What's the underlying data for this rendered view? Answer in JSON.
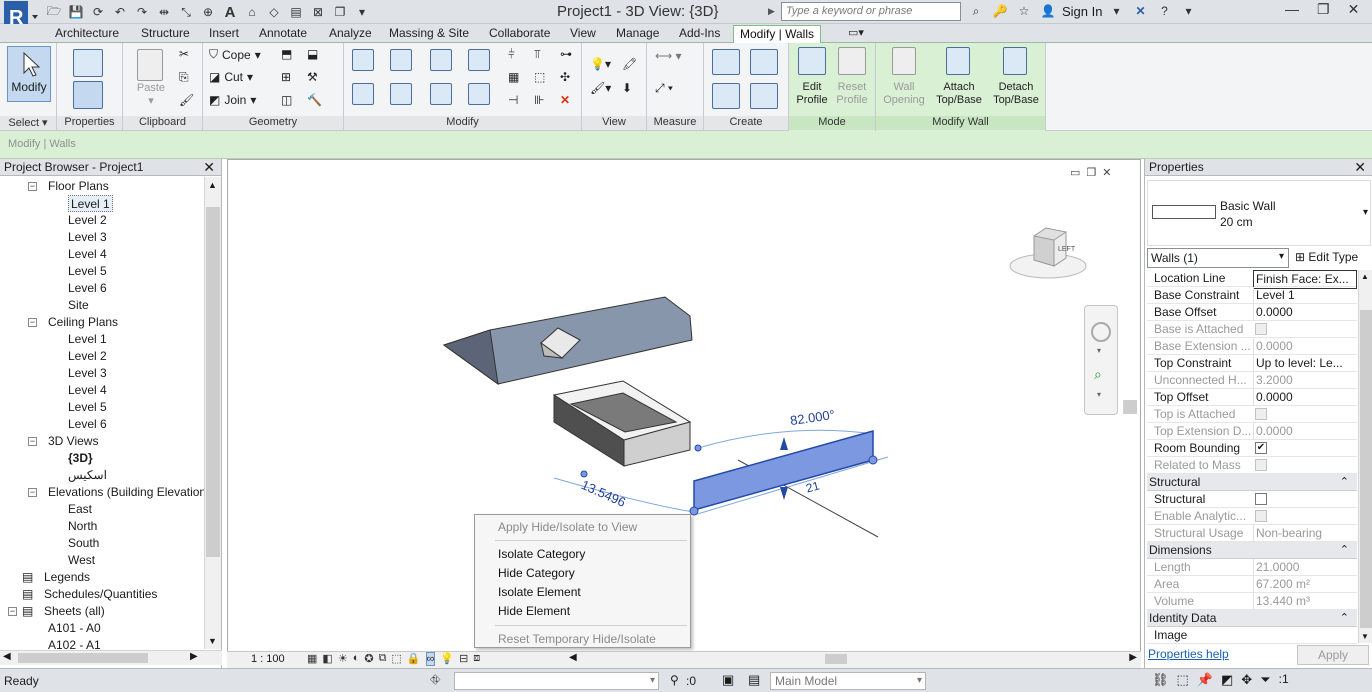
{
  "app": {
    "window_title": "Project1 - 3D View: {3D}",
    "search_placeholder": "Type a keyword or phrase",
    "sign_in": "Sign In",
    "brand_color": "#2a5ea8"
  },
  "tabs": [
    "Architecture",
    "Structure",
    "Insert",
    "Annotate",
    "Analyze",
    "Massing & Site",
    "Collaborate",
    "View",
    "Manage",
    "Add-Ins",
    "Modify | Walls"
  ],
  "ribbon": {
    "select_panel": {
      "modify": "Modify",
      "label": "Select"
    },
    "properties_panel": {
      "label": "Properties"
    },
    "clipboard_panel": {
      "paste": "Paste",
      "label": "Clipboard"
    },
    "geometry_panel": {
      "cope": "Cope",
      "cut": "Cut",
      "join": "Join",
      "label": "Geometry"
    },
    "modify_panel": {
      "label": "Modify"
    },
    "view_panel": {
      "label": "View"
    },
    "measure_panel": {
      "label": "Measure"
    },
    "create_panel": {
      "label": "Create"
    },
    "mode_panel": {
      "edit_profile": [
        "Edit",
        "Profile"
      ],
      "reset_profile": [
        "Reset",
        "Profile"
      ],
      "label": "Mode"
    },
    "modify_wall_panel": {
      "wall_opening": [
        "Wall",
        "Opening"
      ],
      "attach": [
        "Attach",
        "Top/Base"
      ],
      "detach": [
        "Detach",
        "Top/Base"
      ],
      "label": "Modify Wall"
    }
  },
  "context_label": "Modify | Walls",
  "project_browser": {
    "title": "Project Browser - Project1",
    "items": [
      {
        "text": "Floor Plans",
        "level": 1,
        "expander": "−"
      },
      {
        "text": "Level 1",
        "level": 2,
        "selected": true
      },
      {
        "text": "Level 2",
        "level": 2
      },
      {
        "text": "Level 3",
        "level": 2
      },
      {
        "text": "Level 4",
        "level": 2
      },
      {
        "text": "Level 5",
        "level": 2
      },
      {
        "text": "Level 6",
        "level": 2
      },
      {
        "text": "Site",
        "level": 2
      },
      {
        "text": "Ceiling Plans",
        "level": 1,
        "expander": "−"
      },
      {
        "text": "Level 1",
        "level": 2
      },
      {
        "text": "Level 2",
        "level": 2
      },
      {
        "text": "Level 3",
        "level": 2
      },
      {
        "text": "Level 4",
        "level": 2
      },
      {
        "text": "Level 5",
        "level": 2
      },
      {
        "text": "Level 6",
        "level": 2
      },
      {
        "text": "3D Views",
        "level": 1,
        "expander": "−"
      },
      {
        "text": "{3D}",
        "level": 2,
        "bold": true
      },
      {
        "text": "اسكيس",
        "level": 2
      },
      {
        "text": "Elevations (Building Elevation",
        "level": 1,
        "expander": "−"
      },
      {
        "text": "East",
        "level": 2
      },
      {
        "text": "North",
        "level": 2
      },
      {
        "text": "South",
        "level": 2
      },
      {
        "text": "West",
        "level": 2
      },
      {
        "text": "Legends",
        "level": 0,
        "icon": true
      },
      {
        "text": "Schedules/Quantities",
        "level": 0,
        "icon": true
      },
      {
        "text": "Sheets (all)",
        "level": 0,
        "icon": true,
        "expander": "−"
      },
      {
        "text": "A101 - A0",
        "level": 1
      },
      {
        "text": "A102 - A1",
        "level": 1
      }
    ]
  },
  "view": {
    "dim_angle": "82.000°",
    "dim_length": "13.5496",
    "dim_21": "21",
    "viewcube_label": "LEFT",
    "scale": "1 : 100"
  },
  "context_menu": {
    "items": [
      {
        "text": "Apply Hide/Isolate to View",
        "disabled": true
      },
      {
        "text": "Isolate Category"
      },
      {
        "text": "Hide Category"
      },
      {
        "text": "Isolate Element"
      },
      {
        "text": "Hide Element"
      },
      {
        "text": "Reset Temporary Hide/Isolate",
        "disabled": true
      }
    ]
  },
  "properties": {
    "title": "Properties",
    "type_name": "Basic Wall",
    "type_sub": "20 cm",
    "selector": "Walls (1)",
    "edit_type": "Edit Type",
    "rows1": [
      {
        "k": "Location Line",
        "v": "Finish Face: Ex..."
      },
      {
        "k": "Base Constraint",
        "v": "Level 1"
      },
      {
        "k": "Base Offset",
        "v": "0.0000"
      },
      {
        "k": "Base is Attached",
        "v": "",
        "dis": true,
        "chk": "off"
      },
      {
        "k": "Base Extension ...",
        "v": "0.0000",
        "dis": true
      },
      {
        "k": "Top Constraint",
        "v": "Up to level: Le..."
      },
      {
        "k": "Unconnected H...",
        "v": "3.2000",
        "dis": true
      },
      {
        "k": "Top Offset",
        "v": "0.0000"
      },
      {
        "k": "Top is Attached",
        "v": "",
        "dis": true,
        "chk": "off"
      },
      {
        "k": "Top Extension D...",
        "v": "0.0000",
        "dis": true
      },
      {
        "k": "Room Bounding",
        "v": "",
        "chk": "on"
      },
      {
        "k": "Related to Mass",
        "v": "",
        "dis": true,
        "chk": "off"
      }
    ],
    "sec_structural": "Structural",
    "rows2": [
      {
        "k": "Structural",
        "v": "",
        "chk": "empty"
      },
      {
        "k": "Enable Analytic...",
        "v": "",
        "dis": true,
        "chk": "off"
      },
      {
        "k": "Structural Usage",
        "v": "Non-bearing",
        "dis": true
      }
    ],
    "sec_dimensions": "Dimensions",
    "rows3": [
      {
        "k": "Length",
        "v": "21.0000",
        "dis": true
      },
      {
        "k": "Area",
        "v": "67.200 m²",
        "dis": true
      },
      {
        "k": "Volume",
        "v": "13.440 m³",
        "dis": true
      }
    ],
    "sec_identity": "Identity Data",
    "rows4": [
      {
        "k": "Image",
        "v": ""
      }
    ],
    "help_link": "Properties help",
    "apply": "Apply"
  },
  "status": {
    "ready": "Ready",
    "zero": ":0",
    "model": "Main Model",
    "filter_count": ":1"
  }
}
